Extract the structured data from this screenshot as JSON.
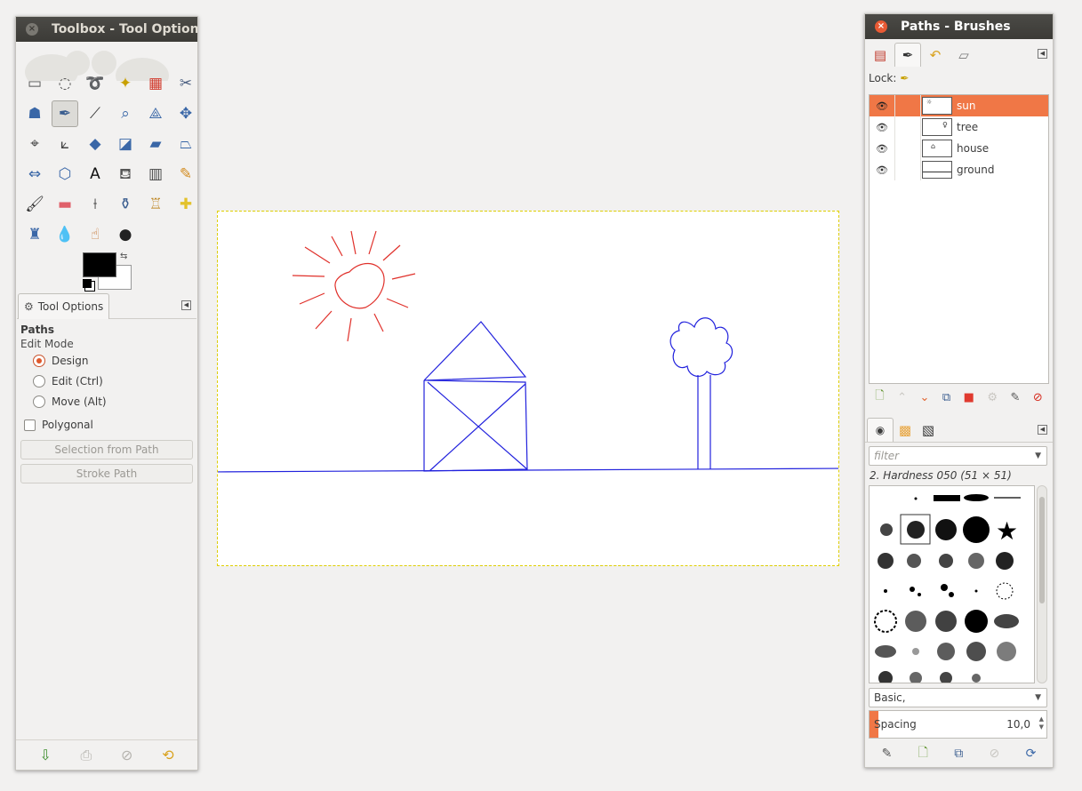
{
  "toolbox": {
    "title": "Toolbox - Tool Options",
    "close_label": "×",
    "tools": [
      {
        "name": "rect-select-icon",
        "glyph": "▭",
        "color": "#555"
      },
      {
        "name": "ellipse-select-icon",
        "glyph": "◌",
        "color": "#555"
      },
      {
        "name": "free-select-icon",
        "glyph": "➰",
        "color": "#666"
      },
      {
        "name": "fuzzy-select-icon",
        "glyph": "✦",
        "color": "#c8a000"
      },
      {
        "name": "select-by-color-icon",
        "glyph": "▦",
        "color": "#d13b2d"
      },
      {
        "name": "scissors-select-icon",
        "glyph": "✂",
        "color": "#4a5e80"
      },
      {
        "name": "foreground-select-icon",
        "glyph": "☗",
        "color": "#3a67a7"
      },
      {
        "name": "paths-tool-icon",
        "glyph": "✒",
        "color": "#3a5d8f",
        "selected": true
      },
      {
        "name": "color-picker-icon",
        "glyph": "⟋",
        "color": "#333"
      },
      {
        "name": "zoom-icon",
        "glyph": "⌕",
        "color": "#3a67a7"
      },
      {
        "name": "measure-icon",
        "glyph": "⟁",
        "color": "#3a67a7"
      },
      {
        "name": "move-icon",
        "glyph": "✥",
        "color": "#3a67a7"
      },
      {
        "name": "align-icon",
        "glyph": "⌖",
        "color": "#444"
      },
      {
        "name": "crop-icon",
        "glyph": "⟀",
        "color": "#444"
      },
      {
        "name": "rotate-icon",
        "glyph": "◆",
        "color": "#3a67a7"
      },
      {
        "name": "scale-icon",
        "glyph": "◪",
        "color": "#3a67a7"
      },
      {
        "name": "shear-icon",
        "glyph": "▰",
        "color": "#3a67a7"
      },
      {
        "name": "perspective-icon",
        "glyph": "⏢",
        "color": "#3a67a7"
      },
      {
        "name": "flip-icon",
        "glyph": "⇔",
        "color": "#3a67a7"
      },
      {
        "name": "cage-transform-icon",
        "glyph": "⬡",
        "color": "#3a67a7"
      },
      {
        "name": "text-tool-icon",
        "glyph": "A",
        "color": "#111"
      },
      {
        "name": "bucket-fill-icon",
        "glyph": "⛾",
        "color": "#555"
      },
      {
        "name": "blend-icon",
        "glyph": "▥",
        "color": "#444"
      },
      {
        "name": "pencil-icon",
        "glyph": "✎",
        "color": "#d38b1e"
      },
      {
        "name": "paintbrush-icon",
        "glyph": "🖌",
        "color": "#333"
      },
      {
        "name": "eraser-icon",
        "glyph": "▬",
        "color": "#e0606a"
      },
      {
        "name": "airbrush-icon",
        "glyph": "⟊",
        "color": "#444"
      },
      {
        "name": "ink-icon",
        "glyph": "⚱",
        "color": "#3a5d8f"
      },
      {
        "name": "clone-icon",
        "glyph": "♖",
        "color": "#c08a2b"
      },
      {
        "name": "heal-icon",
        "glyph": "✚",
        "color": "#e3c22c"
      },
      {
        "name": "perspective-clone-icon",
        "glyph": "♜",
        "color": "#3a67a7"
      },
      {
        "name": "blur-icon",
        "glyph": "💧",
        "color": "#3a8ad2"
      },
      {
        "name": "smudge-icon",
        "glyph": "☝",
        "color": "#c87a3a"
      },
      {
        "name": "dodge-burn-icon",
        "glyph": "●",
        "color": "#222"
      }
    ],
    "tool_options_tab": "Tool Options",
    "options": {
      "title": "Paths",
      "edit_mode_label": "Edit Mode",
      "modes": [
        "Design",
        "Edit (Ctrl)",
        "Move (Alt)"
      ],
      "selected_mode": 0,
      "polygonal_label": "Polygonal",
      "selection_from_path": "Selection from Path",
      "stroke_path": "Stroke Path"
    },
    "bottom_icons": [
      "save-preset-icon",
      "restore-preset-icon",
      "delete-preset-icon",
      "reset-icon"
    ]
  },
  "canvas": {
    "background": "#ffffff",
    "sun_color": "#e0302a",
    "house_tree_color": "#2222dd"
  },
  "paths_window": {
    "title": "Paths - Brushes",
    "close_label": "×",
    "lock_label": "Lock:",
    "paths": [
      {
        "name": "sun",
        "visible_icon": "👁",
        "selected": true
      },
      {
        "name": "tree",
        "visible_icon": "👁",
        "selected": false
      },
      {
        "name": "house",
        "visible_icon": "👁",
        "selected": false
      },
      {
        "name": "ground",
        "visible_icon": "👁",
        "selected": false
      }
    ],
    "accent": "#f07746"
  },
  "brushes": {
    "filter_placeholder": "filter",
    "selected_brush": "2. Hardness 050 (51 × 51)",
    "tag_combo": "Basic,",
    "spacing_label": "Spacing",
    "spacing_value": "10,0",
    "spacing_fraction": 0.05
  }
}
